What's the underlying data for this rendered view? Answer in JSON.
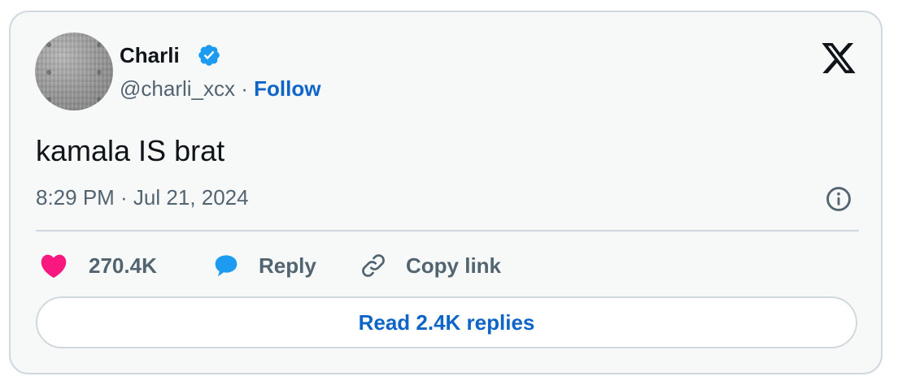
{
  "author": {
    "display_name": "Charli",
    "handle": "@charli_xcx",
    "separator": "·",
    "follow_label": "Follow"
  },
  "tweet": {
    "text": "kamala IS brat",
    "timestamp": "8:29 PM · Jul 21, 2024"
  },
  "actions": {
    "likes_count": "270.4K",
    "reply_label": "Reply",
    "copy_link_label": "Copy link"
  },
  "replies_button_label": "Read 2.4K replies",
  "icons": {
    "avatar": "avatar-image",
    "verified": "verified-badge-icon",
    "brand": "x-logo-icon",
    "info": "info-icon",
    "like": "heart-icon",
    "reply": "speech-bubble-icon",
    "copy_link": "link-icon"
  },
  "colors": {
    "verified": "#1d9bf0",
    "heart": "#f91880",
    "reply_bubble": "#1d9bf0",
    "link_blue": "#0f65c7",
    "text_primary": "#0f1419",
    "text_secondary": "#536471",
    "border": "#cfd9de",
    "card_bg": "#f7f9f9"
  }
}
